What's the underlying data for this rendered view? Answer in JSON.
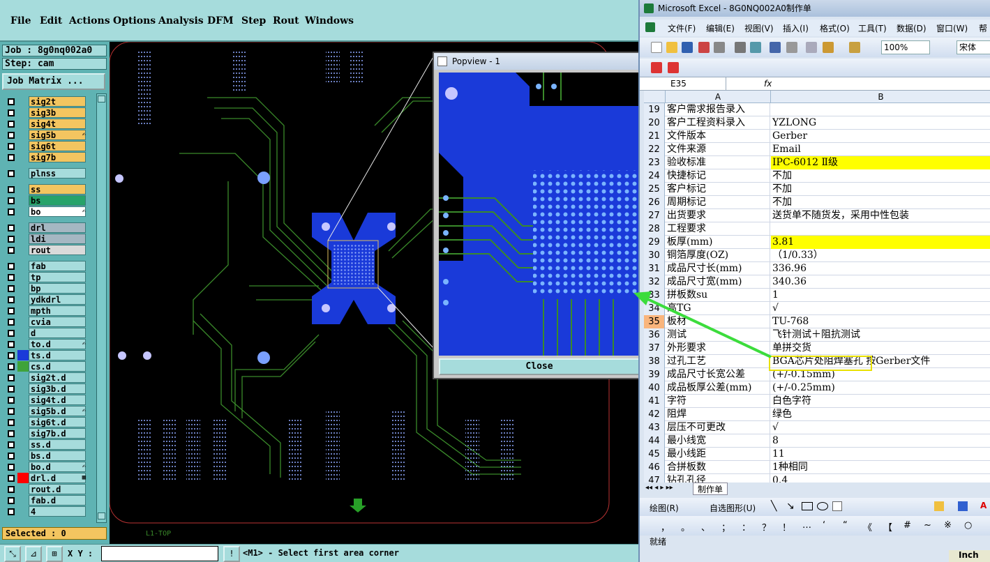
{
  "cam": {
    "menu": [
      "File",
      "Edit",
      "Actions",
      "Options",
      "Analysis",
      "DFM",
      "Step",
      "Rout",
      "Windows"
    ],
    "job_label": "Job : 8g0nq002a0",
    "step_label": "Step: cam",
    "job_matrix_label": "Job Matrix ...",
    "layers": [
      {
        "name": "sig2t",
        "color": "#f3c560",
        "mark": ""
      },
      {
        "name": "sig3b",
        "color": "#f3c560",
        "mark": ""
      },
      {
        "name": "sig4t",
        "color": "#f3c560",
        "mark": ""
      },
      {
        "name": "sig5b",
        "color": "#f3c560",
        "mark": "✍"
      },
      {
        "name": "sig6t",
        "color": "#f3c560",
        "mark": ""
      },
      {
        "name": "sig7b",
        "color": "#f3c560",
        "mark": ""
      },
      {
        "name": "plnss",
        "color": "#a6dcdc",
        "mark": ""
      },
      {
        "name": "ss",
        "color": "#f3c560",
        "mark": ""
      },
      {
        "name": "bs",
        "color": "#27a36a",
        "mark": ""
      },
      {
        "name": "bo",
        "color": "#ffffff",
        "mark": "✍"
      },
      {
        "name": "drl",
        "color": "#a5b7c2",
        "mark": ""
      },
      {
        "name": "ldi",
        "color": "#a5b7c2",
        "mark": ""
      },
      {
        "name": "rout",
        "color": "#dadada",
        "mark": ""
      },
      {
        "name": "fab",
        "color": "#a6dcdc",
        "mark": ""
      },
      {
        "name": "tp",
        "color": "#a6dcdc",
        "mark": ""
      },
      {
        "name": "bp",
        "color": "#a6dcdc",
        "mark": ""
      },
      {
        "name": "ydkdrl",
        "color": "#a6dcdc",
        "mark": ""
      },
      {
        "name": "mpth",
        "color": "#a6dcdc",
        "mark": ""
      },
      {
        "name": "cvia",
        "color": "#a6dcdc",
        "mark": ""
      },
      {
        "name": "d",
        "color": "#a6dcdc",
        "mark": ""
      },
      {
        "name": "to.d",
        "color": "#a6dcdc",
        "mark": "✍"
      },
      {
        "name": "ts.d",
        "color": "#a6dcdc",
        "mark": "",
        "swatch": "#1a3ad9"
      },
      {
        "name": "cs.d",
        "color": "#a6dcdc",
        "mark": "",
        "swatch": "#3fa33a"
      },
      {
        "name": "sig2t.d",
        "color": "#a6dcdc",
        "mark": ""
      },
      {
        "name": "sig3b.d",
        "color": "#a6dcdc",
        "mark": ""
      },
      {
        "name": "sig4t.d",
        "color": "#a6dcdc",
        "mark": ""
      },
      {
        "name": "sig5b.d",
        "color": "#a6dcdc",
        "mark": "✍"
      },
      {
        "name": "sig6t.d",
        "color": "#a6dcdc",
        "mark": ""
      },
      {
        "name": "sig7b.d",
        "color": "#a6dcdc",
        "mark": ""
      },
      {
        "name": "ss.d",
        "color": "#a6dcdc",
        "mark": ""
      },
      {
        "name": "bs.d",
        "color": "#a6dcdc",
        "mark": ""
      },
      {
        "name": "bo.d",
        "color": "#a6dcdc",
        "mark": "✍"
      },
      {
        "name": "drl.d",
        "color": "#a6dcdc",
        "mark": "▦",
        "swatch": "#ff0000"
      },
      {
        "name": "rout.d",
        "color": "#a6dcdc",
        "mark": ""
      },
      {
        "name": "fab.d",
        "color": "#a6dcdc",
        "mark": ""
      },
      {
        "name": "4",
        "color": "#a6dcdc",
        "mark": ""
      }
    ],
    "selected_label": "Selected : 0",
    "xy_label": "X Y :",
    "prompt_text": "<M1> - Select first area corner",
    "canvas_layer_label": "L1-TOP"
  },
  "popview": {
    "title": "Popview - 1",
    "close_label": "Close"
  },
  "excel": {
    "title": "Microsoft Excel - 8G0NQ002A0制作单",
    "menu": [
      "文件(F)",
      "编辑(E)",
      "视图(V)",
      "插入(I)",
      "格式(O)",
      "工具(T)",
      "数据(D)",
      "窗口(W)",
      "帮"
    ],
    "zoom": "100%",
    "font": "宋体",
    "name_box": "E35",
    "fx": "fx",
    "col_a": "A",
    "col_b": "B",
    "rows": [
      {
        "n": "19",
        "a": "客户需求报告录入",
        "b": "",
        "hl": false
      },
      {
        "n": "20",
        "a": "客户工程资料录入",
        "b": "YZLONG",
        "hl": false
      },
      {
        "n": "21",
        "a": "文件版本",
        "b": "Gerber",
        "hl": false
      },
      {
        "n": "22",
        "a": "文件来源",
        "b": "Email",
        "hl": false
      },
      {
        "n": "23",
        "a": "验收标准",
        "b": "IPC-6012 Ⅱ级",
        "hl": true
      },
      {
        "n": "24",
        "a": "快捷标记",
        "b": "不加",
        "hl": false
      },
      {
        "n": "25",
        "a": "客户标记",
        "b": "不加",
        "hl": false
      },
      {
        "n": "26",
        "a": "周期标记",
        "b": "不加",
        "hl": false
      },
      {
        "n": "27",
        "a": "出货要求",
        "b": "送货单不随货发，采用中性包装",
        "hl": false
      },
      {
        "n": "28",
        "a": "工程要求",
        "b": "",
        "hl": false
      },
      {
        "n": "29",
        "a": "板厚(mm)",
        "b": "3.81",
        "hl": true
      },
      {
        "n": "30",
        "a": "铜箔厚度(OZ)",
        "b": "（1/0.33）",
        "hl": false
      },
      {
        "n": "31",
        "a": "成品尺寸长(mm)",
        "b": "336.96",
        "hl": false
      },
      {
        "n": "32",
        "a": "成品尺寸宽(mm)",
        "b": "340.36",
        "hl": false
      },
      {
        "n": "33",
        "a": "拼板数su",
        "b": "1",
        "hl": false
      },
      {
        "n": "34",
        "a": "高TG",
        "b": "√",
        "hl": false
      },
      {
        "n": "35",
        "a": "板材",
        "b": "TU-768",
        "hl": false
      },
      {
        "n": "36",
        "a": "测试",
        "b": "飞针测试＋阻抗测试",
        "hl": false
      },
      {
        "n": "37",
        "a": "外形要求",
        "b": "单拼交货",
        "hl": false
      },
      {
        "n": "38",
        "a": "过孔工艺",
        "b": "BGA芯片处阻焊塞孔 按Gerber文件",
        "hl": false
      },
      {
        "n": "39",
        "a": "成品尺寸长宽公差",
        "b": "(+/-0.15mm)",
        "hl": false
      },
      {
        "n": "40",
        "a": "成品板厚公差(mm)",
        "b": "(+/-0.25mm)",
        "hl": false
      },
      {
        "n": "41",
        "a": "字符",
        "b": "白色字符",
        "hl": false
      },
      {
        "n": "42",
        "a": "阻焊",
        "b": "绿色",
        "hl": false
      },
      {
        "n": "43",
        "a": "层压不可更改",
        "b": "√",
        "hl": false
      },
      {
        "n": "44",
        "a": "最小线宽",
        "b": "8",
        "hl": false
      },
      {
        "n": "45",
        "a": "最小线距",
        "b": "11",
        "hl": false
      },
      {
        "n": "46",
        "a": "合拼板数",
        "b": "1种相同",
        "hl": false
      },
      {
        "n": "47",
        "a": "钻孔孔径",
        "b": "0.4",
        "hl": false
      }
    ],
    "sheet_tab": "制作单",
    "draw_label": "绘图(R)",
    "autoshape_label": "自选图形(U)",
    "symbols": [
      "，",
      "。",
      "、",
      "；",
      "：",
      "？",
      "！",
      "…",
      "‘",
      "“",
      "《",
      "【",
      "#",
      "~",
      "※",
      "○"
    ],
    "status": "就绪",
    "taskbar_hint": "Inch"
  },
  "colors": {
    "accent_arrow": "#3cdc3c",
    "annotation_box": "#e8e000"
  }
}
